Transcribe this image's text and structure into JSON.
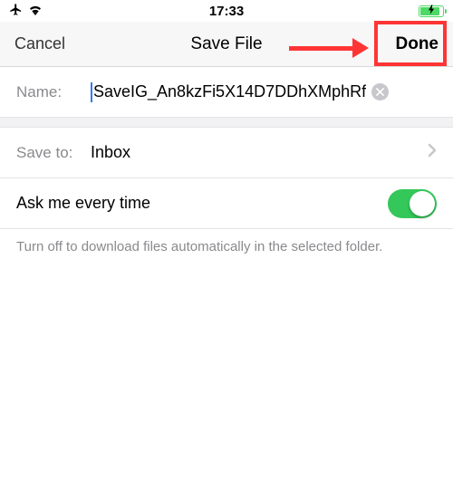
{
  "statusBar": {
    "time": "17:33"
  },
  "nav": {
    "cancel": "Cancel",
    "title": "Save File",
    "done": "Done"
  },
  "nameRow": {
    "label": "Name:",
    "value": "SaveIG_An8kzFi5X14D7DDhXMphRf"
  },
  "saveToRow": {
    "label": "Save to:",
    "value": "Inbox"
  },
  "askRow": {
    "label": "Ask me every time",
    "enabled": true
  },
  "footer": "Turn off to download files automatically in the selected folder."
}
